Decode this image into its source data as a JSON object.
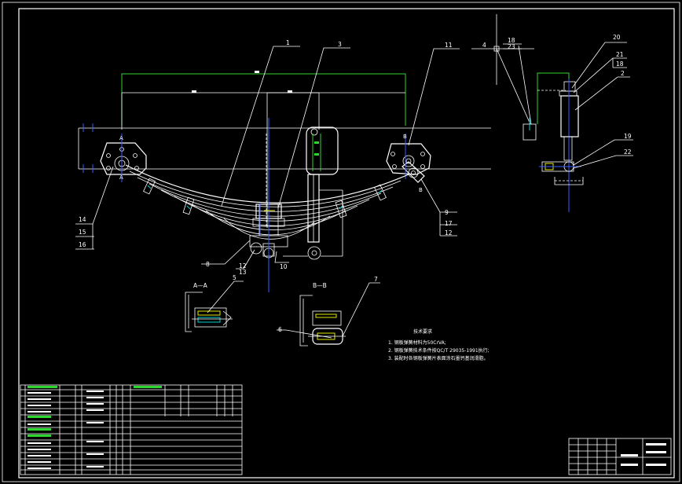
{
  "drawing": {
    "part_labels": [
      "1",
      "3",
      "11",
      "4",
      "18",
      "23",
      "20",
      "21",
      "18",
      "2",
      "19",
      "22",
      "14",
      "15",
      "16",
      "9",
      "17",
      "12",
      "8",
      "12",
      "13",
      "10",
      "5",
      "7",
      "6"
    ],
    "section_labels": [
      "A—A",
      "B—B"
    ],
    "view_marks": [
      "A",
      "A",
      "B",
      "B"
    ]
  },
  "tech_notes": {
    "title": "技术要求",
    "line1": "1. 钢板弹簧材料为50CrVA;",
    "line2": "2. 钢板弹簧技术条件按QC/T 29035-1991执行;",
    "line3": "3. 装配时各钢板弹簧片表面涂石墨钙基润滑脂。"
  },
  "colors": {
    "background": "#000000",
    "line": "#ffffff",
    "dimension": "#2fd52f",
    "centerline": "#3a5cff",
    "highlight": "#e6e600",
    "cyan": "#00d0d0"
  }
}
